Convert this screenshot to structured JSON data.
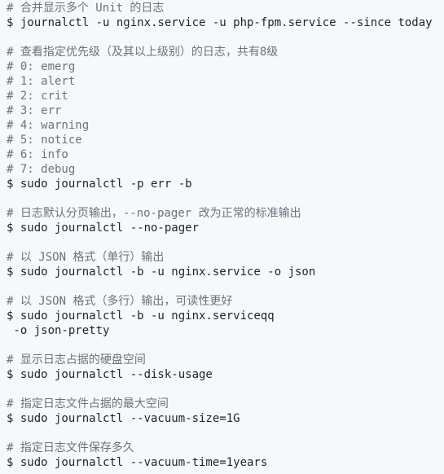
{
  "lines": [
    {
      "type": "comment",
      "text": "# 合并显示多个 Unit 的日志"
    },
    {
      "type": "command",
      "text": "$ journalctl -u nginx.service -u php-fpm.service --since today"
    },
    {
      "type": "blank",
      "text": ""
    },
    {
      "type": "comment",
      "text": "# 查看指定优先级（及其以上级别）的日志，共有8级"
    },
    {
      "type": "comment",
      "text": "# 0: emerg"
    },
    {
      "type": "comment",
      "text": "# 1: alert"
    },
    {
      "type": "comment",
      "text": "# 2: crit"
    },
    {
      "type": "comment",
      "text": "# 3: err"
    },
    {
      "type": "comment",
      "text": "# 4: warning"
    },
    {
      "type": "comment",
      "text": "# 5: notice"
    },
    {
      "type": "comment",
      "text": "# 6: info"
    },
    {
      "type": "comment",
      "text": "# 7: debug"
    },
    {
      "type": "command",
      "text": "$ sudo journalctl -p err -b"
    },
    {
      "type": "blank",
      "text": ""
    },
    {
      "type": "comment",
      "text": "# 日志默认分页输出，--no-pager 改为正常的标准输出"
    },
    {
      "type": "command",
      "text": "$ sudo journalctl --no-pager"
    },
    {
      "type": "blank",
      "text": ""
    },
    {
      "type": "comment",
      "text": "# 以 JSON 格式（单行）输出"
    },
    {
      "type": "command",
      "text": "$ sudo journalctl -b -u nginx.service -o json"
    },
    {
      "type": "blank",
      "text": ""
    },
    {
      "type": "comment",
      "text": "# 以 JSON 格式（多行）输出，可读性更好"
    },
    {
      "type": "command",
      "text": "$ sudo journalctl -b -u nginx.serviceqq"
    },
    {
      "type": "command",
      "text": " -o json-pretty"
    },
    {
      "type": "blank",
      "text": ""
    },
    {
      "type": "comment",
      "text": "# 显示日志占据的硬盘空间"
    },
    {
      "type": "command",
      "text": "$ sudo journalctl --disk-usage"
    },
    {
      "type": "blank",
      "text": ""
    },
    {
      "type": "comment",
      "text": "# 指定日志文件占据的最大空间"
    },
    {
      "type": "command",
      "text": "$ sudo journalctl --vacuum-size=1G"
    },
    {
      "type": "blank",
      "text": ""
    },
    {
      "type": "comment",
      "text": "# 指定日志文件保存多久"
    },
    {
      "type": "command",
      "text": "$ sudo journalctl --vacuum-time=1years"
    }
  ]
}
